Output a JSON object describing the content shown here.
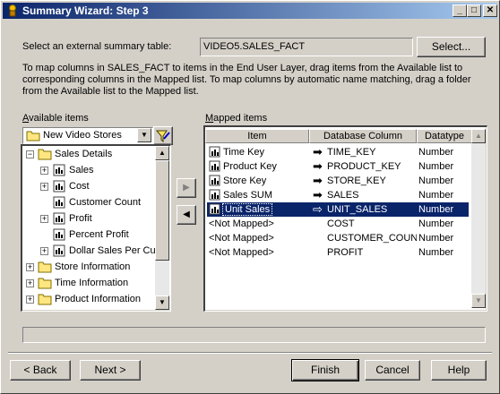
{
  "window": {
    "title": "Summary Wizard: Step 3",
    "min_icon": "minimize-icon",
    "max_icon": "maximize-icon",
    "close_icon": "close-icon"
  },
  "summary_table": {
    "label": "Select an external summary table:",
    "value": "VIDEO5.SALES_FACT",
    "select_button": "Select..."
  },
  "description": "To map columns in SALES_FACT to items in the End User Layer, drag items from the Available list to corresponding columns in the Mapped list. To map columns by automatic name matching, drag a folder from the Available list to the Mapped list.",
  "available": {
    "label": "Available items",
    "dropdown_value": "New Video Stores",
    "tree": [
      {
        "label": "Sales Details",
        "level": 0,
        "expander": "-",
        "icon": "folder-icon"
      },
      {
        "label": "Sales",
        "level": 1,
        "expander": "+",
        "icon": "item-icon"
      },
      {
        "label": "Cost",
        "level": 1,
        "expander": "+",
        "icon": "item-icon"
      },
      {
        "label": "Customer Count",
        "level": 1,
        "expander": "",
        "icon": "item-icon"
      },
      {
        "label": "Profit",
        "level": 1,
        "expander": "+",
        "icon": "item-icon"
      },
      {
        "label": "Percent Profit",
        "level": 1,
        "expander": "",
        "icon": "item-icon"
      },
      {
        "label": "Dollar Sales Per Cu",
        "level": 1,
        "expander": "+",
        "icon": "item-icon"
      },
      {
        "label": "Store Information",
        "level": 0,
        "expander": "+",
        "icon": "folder-icon"
      },
      {
        "label": "Time Information",
        "level": 0,
        "expander": "+",
        "icon": "folder-icon"
      },
      {
        "label": "Product Information",
        "level": 0,
        "expander": "+",
        "icon": "folder-icon"
      }
    ]
  },
  "mapped": {
    "label": "Mapped items",
    "columns": [
      "Item",
      "Database Column",
      "Datatype"
    ],
    "rows": [
      {
        "item": "Time Key",
        "column": "TIME_KEY",
        "type": "Number",
        "mapped": true,
        "selected": false
      },
      {
        "item": "Product Key",
        "column": "PRODUCT_KEY",
        "type": "Number",
        "mapped": true,
        "selected": false
      },
      {
        "item": "Store Key",
        "column": "STORE_KEY",
        "type": "Number",
        "mapped": true,
        "selected": false
      },
      {
        "item": "Sales SUM",
        "column": "SALES",
        "type": "Number",
        "mapped": true,
        "selected": false
      },
      {
        "item": "Unit Sales",
        "column": "UNIT_SALES",
        "type": "Number",
        "mapped": true,
        "selected": true
      },
      {
        "item": "<Not Mapped>",
        "column": "COST",
        "type": "Number",
        "mapped": false,
        "selected": false
      },
      {
        "item": "<Not Mapped>",
        "column": "CUSTOMER_COUN",
        "type": "Number",
        "mapped": false,
        "selected": false
      },
      {
        "item": "<Not Mapped>",
        "column": "PROFIT",
        "type": "Number",
        "mapped": false,
        "selected": false
      }
    ]
  },
  "buttons": {
    "back": "< Back",
    "next": "Next >",
    "finish": "Finish",
    "cancel": "Cancel",
    "help": "Help"
  },
  "colors": {
    "title_start": "#0a246a",
    "title_end": "#a6caf0",
    "selection": "#0a246a",
    "face": "#d4d0c8"
  }
}
